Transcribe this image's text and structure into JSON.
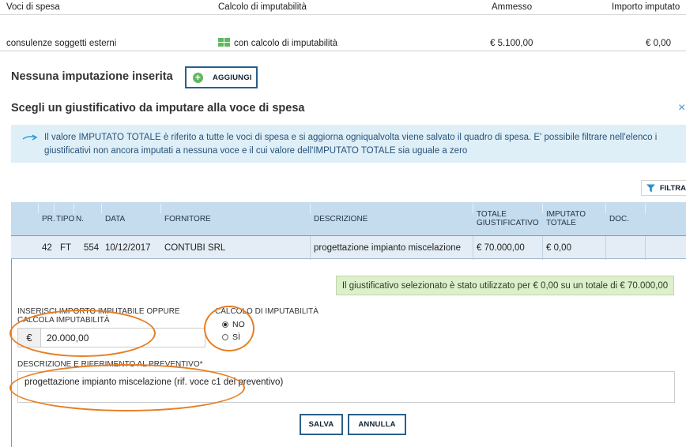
{
  "summary": {
    "headers": [
      "Voci di spesa",
      "Calcolo di imputabilità",
      "Ammesso",
      "Importo imputato"
    ],
    "row": {
      "voce": "consulenze soggetti esterni",
      "calcolo": "con calcolo di imputabilità",
      "ammesso": "€ 5.100,00",
      "importo": "€ 0,00"
    }
  },
  "no_imputation": {
    "title": "Nessuna imputazione inserita",
    "add_label": "AGGIUNGI"
  },
  "section": {
    "title": "Scegli un giustificativo da imputare alla voce di spesa",
    "close_glyph": "×"
  },
  "info": {
    "text": "Il valore IMPUTATO TOTALE è riferito a tutte le voci di spesa e si aggiorna ogniqualvolta viene salvato il quadro di spesa. E' possibile filtrare nell'elenco i giustificativi non ancora imputati a nessuna voce e il cui valore dell'IMPUTATO TOTALE sia uguale a zero"
  },
  "filter": {
    "label": "FILTRA"
  },
  "table": {
    "headers": {
      "pr": "PR.",
      "tipo": "TIPO",
      "n": "N.",
      "data": "DATA",
      "fornitore": "FORNITORE",
      "descrizione": "DESCRIZIONE",
      "totale_1": "TOTALE",
      "totale_2": "GIUSTIFICATIVO",
      "imputato_1": "IMPUTATO",
      "imputato_2": "TOTALE",
      "doc": "DOC."
    },
    "row": {
      "pr": "42",
      "tipo": "FT",
      "n": "554",
      "data": "10/12/2017",
      "fornitore": "CONTUBI SRL",
      "descrizione": "progettazione impianto miscelazione",
      "totale": "€ 70.000,00",
      "imputato": "€ 0,00"
    }
  },
  "detail": {
    "usage_message": "Il giustificativo selezionato è stato utilizzato per € 0,00 su un totale di € 70.000,00",
    "importo_label_1": "INSERISCI IMPORTO IMPUTABILE OPPURE",
    "importo_label_2": "CALCOLA IMPUTABILITÀ",
    "currency": "€",
    "importo_value": "20.000,00",
    "calcolo_label": "CALCOLO DI IMPUTABILITÀ",
    "option_no": "NO",
    "option_si": "SÌ",
    "selected": "NO",
    "descrizione_label": "DESCRIZIONE E RIFERIMENTO AL PREVENTIVO*",
    "descrizione_value": "progettazione impianto miscelazione (rif. voce c1 del preventivo)",
    "save_label": "SALVA",
    "cancel_label": "ANNULLA"
  },
  "colors": {
    "accent_green": "#5fb85f",
    "header_blue": "#c5dcef",
    "info_bg": "#dfeff7",
    "annotation_orange": "#e67e22",
    "button_border": "#2a5f8a"
  }
}
